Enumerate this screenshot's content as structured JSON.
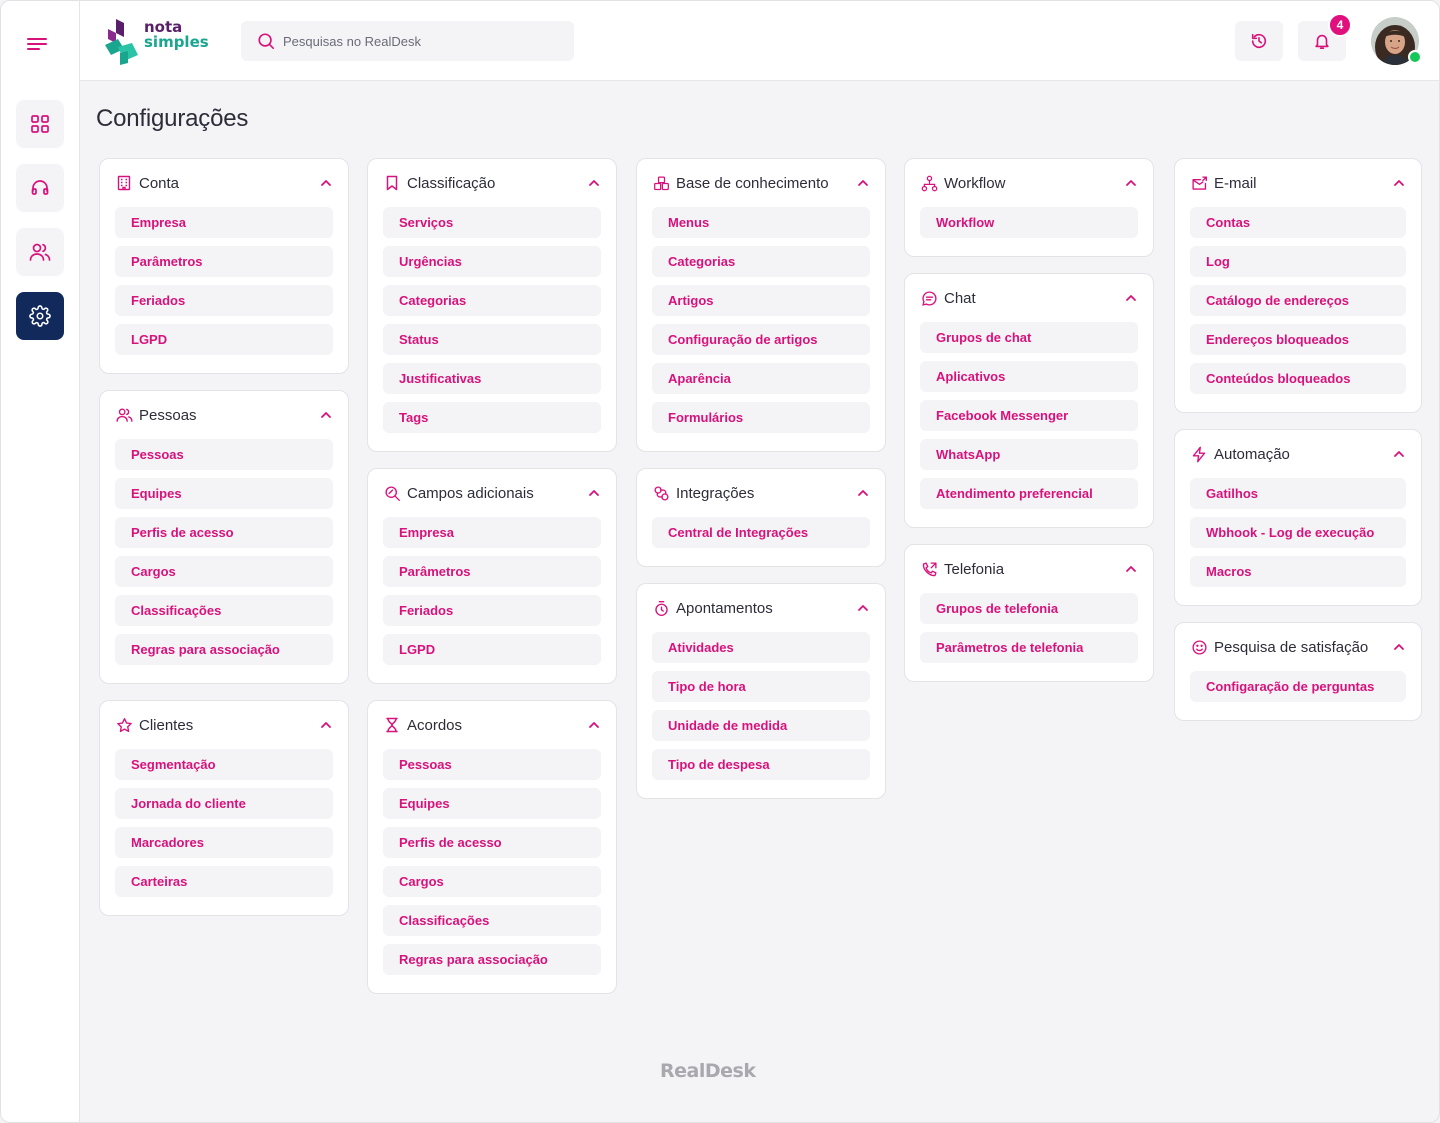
{
  "brand": {
    "logo_line1": "nota",
    "logo_line2": "simples",
    "footer": "RealDesk"
  },
  "search": {
    "placeholder": "Pesquisas no RealDesk"
  },
  "notifications": {
    "count": "4"
  },
  "page_title": "Configurações",
  "colors": {
    "accent": "#d8127c",
    "sidebar_active": "#12295c",
    "online": "#16c75a"
  },
  "sidebar": {
    "items": [
      {
        "name": "dashboard",
        "icon": "grid-icon"
      },
      {
        "name": "support",
        "icon": "headset-icon"
      },
      {
        "name": "people",
        "icon": "users-icon"
      },
      {
        "name": "settings",
        "icon": "gear-icon",
        "active": true
      }
    ]
  },
  "sections": {
    "conta": {
      "title": "Conta",
      "icon": "building-icon",
      "items": [
        "Empresa",
        "Parâmetros",
        "Feriados",
        "LGPD"
      ]
    },
    "pessoas": {
      "title": "Pessoas",
      "icon": "users-icon",
      "items": [
        "Pessoas",
        "Equipes",
        "Perfis de acesso",
        "Cargos",
        "Classificações",
        "Regras para associação"
      ]
    },
    "clientes": {
      "title": "Clientes",
      "icon": "star-icon",
      "items": [
        "Segmentação",
        "Jornada do cliente",
        "Marcadores",
        "Carteiras"
      ]
    },
    "classificacao": {
      "title": "Classificação",
      "icon": "bookmark-icon",
      "items": [
        "Serviços",
        "Urgências",
        "Categorias",
        "Status",
        "Justificativas",
        "Tags"
      ]
    },
    "campos": {
      "title": "Campos adicionais",
      "icon": "search-edit-icon",
      "items": [
        "Empresa",
        "Parâmetros",
        "Feriados",
        "LGPD"
      ]
    },
    "acordos": {
      "title": "Acordos",
      "icon": "hourglass-icon",
      "items": [
        "Pessoas",
        "Equipes",
        "Perfis de acesso",
        "Cargos",
        "Classificações",
        "Regras para associação"
      ]
    },
    "base": {
      "title": "Base de conhecimento",
      "icon": "blocks-icon",
      "items": [
        "Menus",
        "Categorias",
        "Artigos",
        "Configuração de artigos",
        "Aparência",
        "Formulários"
      ]
    },
    "integracoes": {
      "title": "Integrações",
      "icon": "link-icon",
      "items": [
        "Central de Integrações"
      ]
    },
    "apontamentos": {
      "title": "Apontamentos",
      "icon": "timer-icon",
      "items": [
        "Atividades",
        "Tipo de hora",
        "Unidade de medida",
        "Tipo de despesa"
      ]
    },
    "workflow": {
      "title": "Workflow",
      "icon": "workflow-icon",
      "items": [
        "Workflow"
      ]
    },
    "chat": {
      "title": "Chat",
      "icon": "chat-icon",
      "items": [
        "Grupos de chat",
        "Aplicativos",
        "Facebook Messenger",
        "WhatsApp",
        "Atendimento preferencial"
      ]
    },
    "telefonia": {
      "title": "Telefonia",
      "icon": "phone-icon",
      "items": [
        "Grupos de telefonia",
        "Parâmetros de telefonia"
      ]
    },
    "email": {
      "title": "E-mail",
      "icon": "mail-icon",
      "items": [
        "Contas",
        "Log",
        "Catálogo de endereços",
        "Endereços bloqueados",
        "Conteúdos bloqueados"
      ]
    },
    "automacao": {
      "title": "Automação",
      "icon": "lightning-icon",
      "items": [
        "Gatilhos",
        "Wbhook - Log de execução",
        "Macros"
      ]
    },
    "pesquisa": {
      "title": "Pesquisa de satisfação",
      "icon": "smile-icon",
      "items": [
        "Configaração de perguntas"
      ]
    }
  }
}
